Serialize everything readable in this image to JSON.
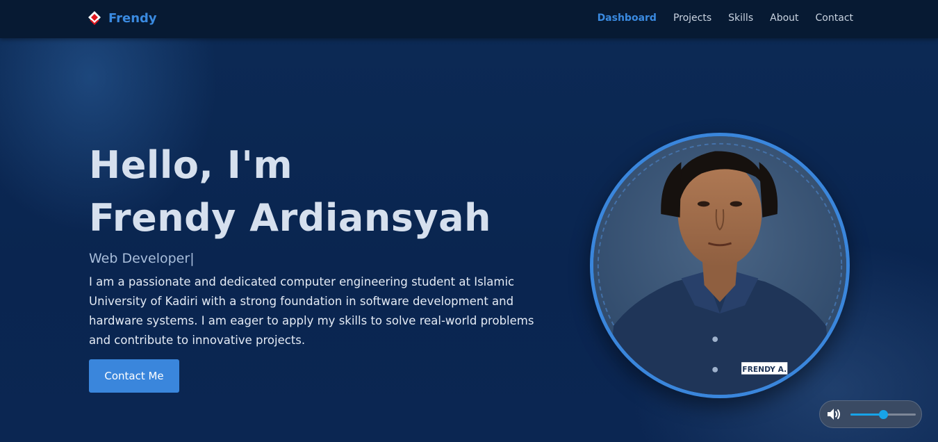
{
  "navbar": {
    "brand": "Frendy",
    "links": [
      {
        "label": "Dashboard",
        "active": true
      },
      {
        "label": "Projects",
        "active": false
      },
      {
        "label": "Skills",
        "active": false
      },
      {
        "label": "About",
        "active": false
      },
      {
        "label": "Contact",
        "active": false
      }
    ]
  },
  "hero": {
    "greeting": "Hello, I'm",
    "name": "Frendy Ardiansyah",
    "role": "Web Developer",
    "cursor": "|",
    "description": "I am a passionate and dedicated computer engineering student at Islamic University of Kadiri with a strong foundation in software development and hardware systems. I am eager to apply my skills to solve real-world problems and contribute to innovative projects.",
    "cta_label": "Contact Me"
  },
  "profile": {
    "name_tag": "FRENDY A."
  },
  "audio": {
    "icon": "speaker-volume-icon",
    "volume": 0.5
  },
  "colors": {
    "accent": "#3a86dc",
    "navbar_bg": "#071a33",
    "background": "#0b2750",
    "slider": "#17a3e8"
  }
}
